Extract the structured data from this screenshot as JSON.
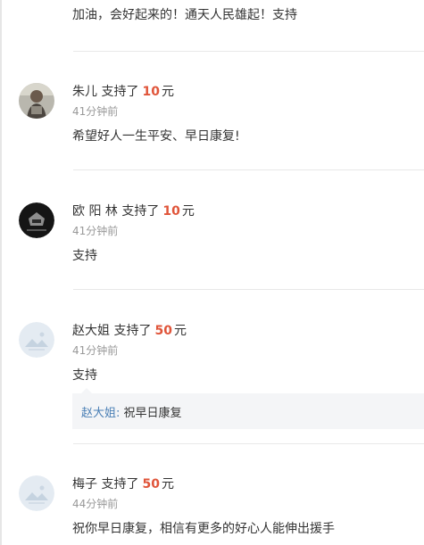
{
  "top_comment": {
    "message": "加油，会好起来的！通天人民雄起！支持"
  },
  "supporters": [
    {
      "name": "朱儿",
      "action": "支持了",
      "amount": "10",
      "unit": "元",
      "time": "41分钟前",
      "message": "希望好人一生平安、早日康复!",
      "avatar_icon": "person-photo-avatar"
    },
    {
      "name": "欧 阳 林",
      "action": "支持了",
      "amount": "10",
      "unit": "元",
      "time": "41分钟前",
      "message": "支持",
      "avatar_icon": "dark-emblem-avatar"
    },
    {
      "name": "赵大姐",
      "action": "支持了",
      "amount": "50",
      "unit": "元",
      "time": "41分钟前",
      "message": "支持",
      "avatar_icon": "default-landscape-avatar",
      "reply": {
        "name": "赵大姐:",
        "text": "祝早日康复"
      }
    },
    {
      "name": "梅子",
      "action": "支持了",
      "amount": "50",
      "unit": "元",
      "time": "44分钟前",
      "message": "祝你早日康复，相信有更多的好心人能伸出援手",
      "avatar_icon": "default-landscape-avatar"
    }
  ],
  "colors": {
    "amount": "#e0553a",
    "reply_name": "#4a7fb5",
    "time": "#999999"
  }
}
